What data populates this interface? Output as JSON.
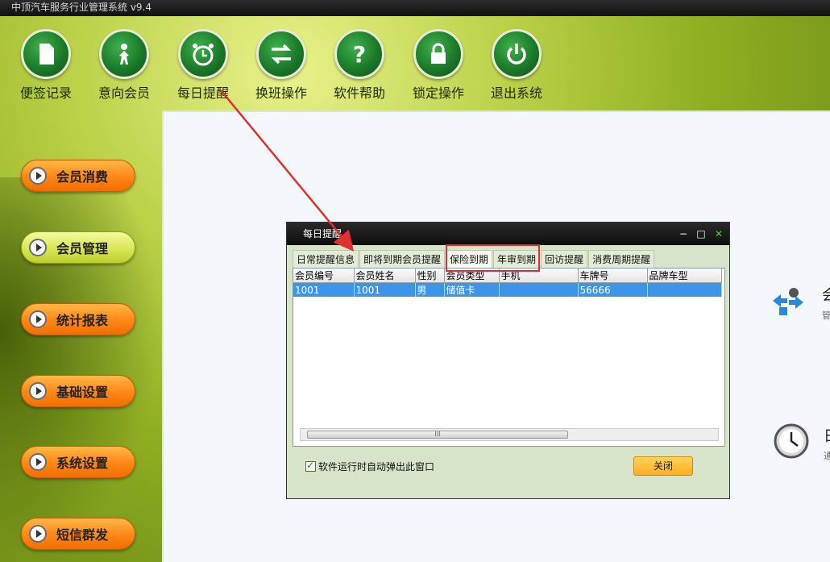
{
  "window": {
    "title": "中顶汽车服务行业管理系统 v9.4"
  },
  "toolbar": [
    {
      "label": "便签记录",
      "icon": "note-icon"
    },
    {
      "label": "意向会员",
      "icon": "person-icon"
    },
    {
      "label": "每日提醒",
      "icon": "alarm-clock-icon"
    },
    {
      "label": "换班操作",
      "icon": "swap-arrows-icon"
    },
    {
      "label": "软件帮助",
      "icon": "question-icon"
    },
    {
      "label": "锁定操作",
      "icon": "lock-icon"
    },
    {
      "label": "退出系统",
      "icon": "power-icon"
    }
  ],
  "sidebar": [
    {
      "label": "会员消费"
    },
    {
      "label": "会员管理",
      "active": true
    },
    {
      "label": "统计报表"
    },
    {
      "label": "基础设置"
    },
    {
      "label": "系统设置"
    },
    {
      "label": "短信群发"
    }
  ],
  "panel_right": {
    "item1": {
      "title": "会",
      "sub": "管"
    },
    "item2": {
      "title": "日",
      "sub": "通"
    }
  },
  "dialog": {
    "title": "每日提醒",
    "tabs": [
      "日常提醒信息",
      "即将到期会员提醒",
      "保险到期",
      "年审到期",
      "回访提醒",
      "消费周期提醒"
    ],
    "selected_tab": "保险到期",
    "columns": [
      "会员编号",
      "会员姓名",
      "性别",
      "会员类型",
      "手机",
      "车牌号",
      "品牌车型"
    ],
    "rows": [
      [
        "1001",
        "1001",
        "男",
        "储值卡",
        "",
        "56666",
        ""
      ]
    ],
    "scroll_thumb": "III",
    "checkbox_label": "软件运行时自动弹出此窗口",
    "checkbox_checked": true,
    "close_label": "关闭"
  },
  "colors": {
    "accent_red": "#e0302f",
    "row_selected": "#3d95e8",
    "button_orange": "#ff8a1a"
  }
}
